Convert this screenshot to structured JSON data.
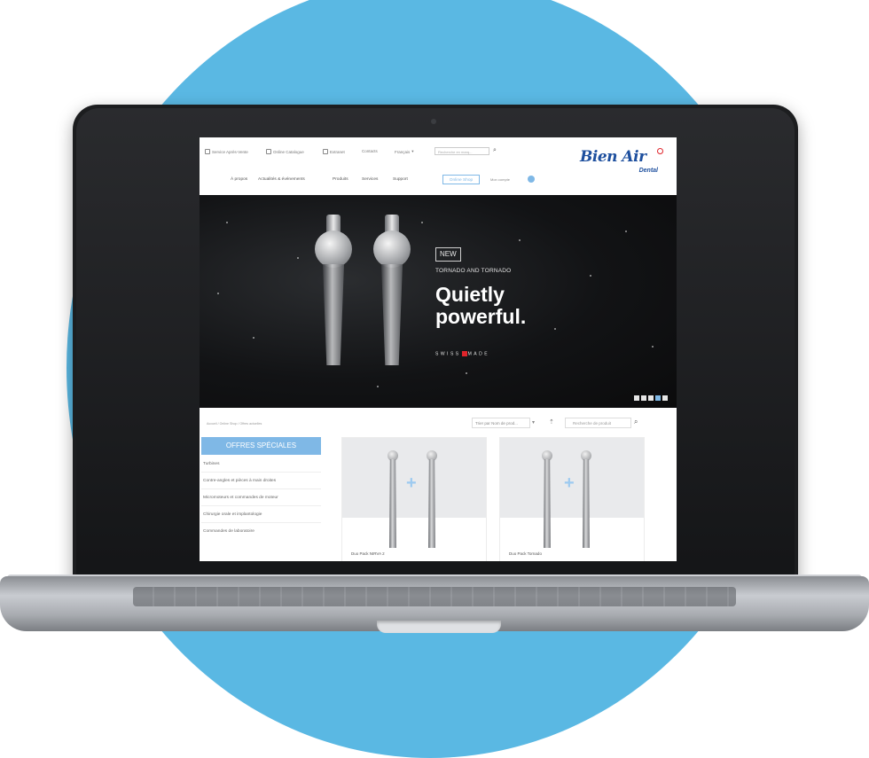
{
  "util_bar": {
    "items": [
      "Service Après-Vente",
      "Online Catalogue",
      "Extranet",
      "Contacts",
      "Français"
    ],
    "search_placeholder": "Recherche en marq...",
    "search_icon": "search-icon"
  },
  "logo": {
    "brand": "Bien Air",
    "sub": "Dental"
  },
  "nav": {
    "items": [
      "À propos",
      "Actualités & événements",
      "Produits",
      "Services",
      "Support"
    ],
    "shop": "Online Shop",
    "account": "Mon compte"
  },
  "hero": {
    "badge": "NEW",
    "subtitle": "TORNADO AND TORNADO",
    "title_line1": "Quietly",
    "title_line2": "powerful.",
    "made_before": "SWISS",
    "made_after": "MADE",
    "slides_total": 5,
    "slide_active": 4
  },
  "breadcrumb": "Accueil / Online Shop / Offres actuelles",
  "sort": {
    "label": "Trier par Nom de prod...",
    "dropdown_icon": "chevron-down-icon",
    "direction_icon": "arrow-up-icon"
  },
  "product_search": {
    "placeholder": "Recherche de produit",
    "icon": "search-icon"
  },
  "sidebar": {
    "heading": "OFFRES SPÉCIALES",
    "items": [
      "Turbines",
      "Contre-angles et pièces à main droites",
      "Micromoteurs et commandes de moteur",
      "Chirurgie orale et implantologie",
      "Commandes de laboratoire"
    ]
  },
  "products": [
    {
      "name": "Duo Pack NIRVA 2"
    },
    {
      "name": "Duo Pack Tornado"
    }
  ],
  "colors": {
    "background_circle": "#5ab8e3",
    "accent": "#7fb8e6",
    "brand": "#1d4f9e"
  }
}
